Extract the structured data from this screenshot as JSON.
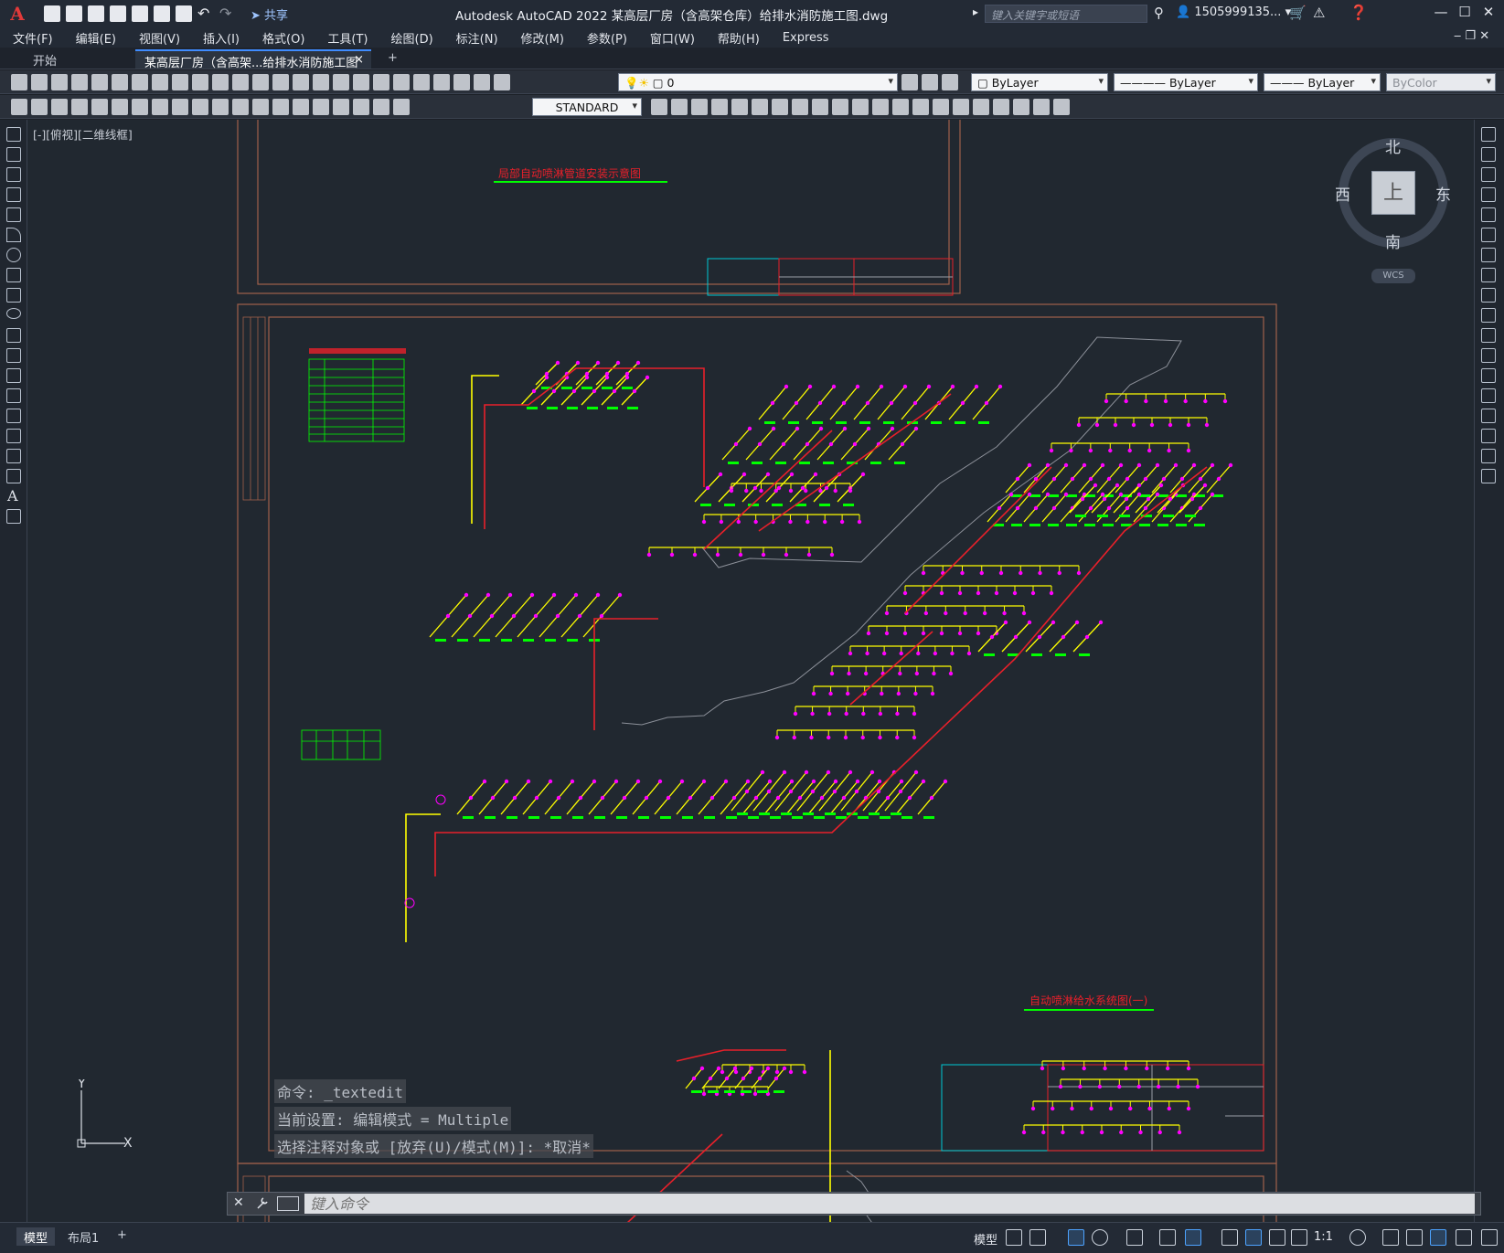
{
  "titlebar": {
    "app_title": "Autodesk AutoCAD 2022    某高层厂房（含高架仓库）给排水消防施工图.dwg",
    "share_label": "共享",
    "search_placeholder": "键入关键字或短语",
    "user": "1505999135...",
    "logo": "A"
  },
  "menu": [
    "文件(F)",
    "编辑(E)",
    "视图(V)",
    "插入(I)",
    "格式(O)",
    "工具(T)",
    "绘图(D)",
    "标注(N)",
    "修改(M)",
    "参数(P)",
    "窗口(W)",
    "帮助(H)",
    "Express"
  ],
  "tabs": {
    "start": "开始",
    "active": "某高层厂房（含高架...给排水消防施工图*",
    "close": "×",
    "add": "+"
  },
  "toolbar": {
    "layer_value": "0",
    "color_value": "ByLayer",
    "linetype_value": "ByLayer",
    "lineweight_value": "ByLayer",
    "plotstyle_value": "ByColor",
    "textstyle_value": "STANDARD"
  },
  "viewport": {
    "label": "[-][俯视][二维线框]"
  },
  "viewcube": {
    "north": "北",
    "south": "南",
    "east": "东",
    "west": "西",
    "top": "上",
    "wcs": "WCS"
  },
  "ucs": {
    "x": "X",
    "y": "Y"
  },
  "drawing_text": {
    "title1": "自动喷淋给水系统图(一)",
    "title2": "局部自动喷淋管道安装示意图"
  },
  "command": {
    "history": [
      "命令: _textedit",
      "当前设置: 编辑模式 = Multiple",
      "选择注释对象或 [放弃(U)/模式(M)]: *取消*"
    ],
    "placeholder": "键入命令"
  },
  "statusbar": {
    "tabs": [
      "模型",
      "布局1"
    ],
    "add": "+",
    "model": "模型",
    "scale": "1:1"
  },
  "colors": {
    "accent": "#3f8cff",
    "pipe_red": "#e8202a",
    "pipe_yellow": "#ffff00",
    "sprinkler_magenta": "#ff00ff",
    "label_green": "#00ff00",
    "frame_brown": "#a0604a"
  }
}
